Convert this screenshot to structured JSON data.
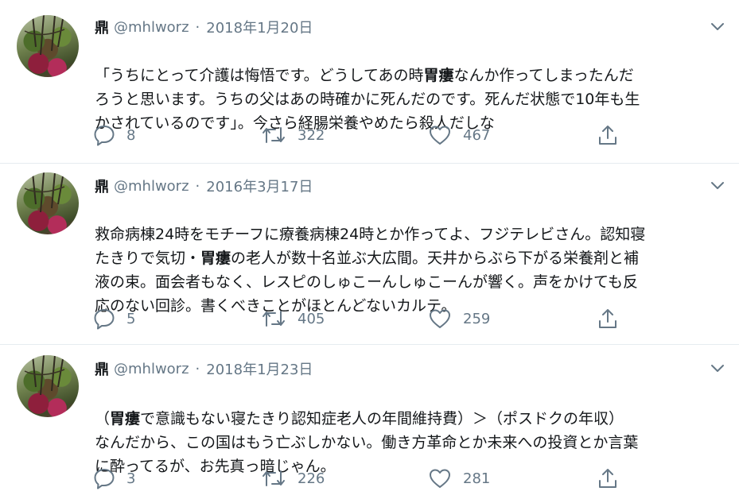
{
  "tweets": [
    {
      "name": "鼎",
      "handle": "@mhlworz",
      "date": "2018年1月20日",
      "text_parts": [
        {
          "t": "「うちにとって介護は悔悟です。どうしてあの時",
          "b": false
        },
        {
          "t": "胃瘻",
          "b": true
        },
        {
          "t": "なんか作ってしまったんだ\nろうと思います。うちの父はあの時確かに死んだのです。死んだ状態で10年も生\nかされているのです」。今さら経腸栄養やめたら殺人だしな",
          "b": false
        }
      ],
      "replies": "8",
      "retweets": "322",
      "likes": "467"
    },
    {
      "name": "鼎",
      "handle": "@mhlworz",
      "date": "2016年3月17日",
      "text_parts": [
        {
          "t": "救命病棟24時をモチーフに療養病棟24時とか作ってよ、フジテレビさん。認知寝\nたきりで気切・",
          "b": false
        },
        {
          "t": "胃瘻",
          "b": true
        },
        {
          "t": "の老人が数十名並ぶ大広間。天井からぶら下がる栄養剤と補\n液の束。面会者もなく、レスピのしゅこーんしゅこーんが響く。声をかけても反\n応のない回診。書くべきことがほとんどないカルテ。",
          "b": false
        }
      ],
      "replies": "5",
      "retweets": "405",
      "likes": "259"
    },
    {
      "name": "鼎",
      "handle": "@mhlworz",
      "date": "2018年1月23日",
      "text_parts": [
        {
          "t": "（",
          "b": false
        },
        {
          "t": "胃瘻",
          "b": true
        },
        {
          "t": "で意識もない寝たきり認知症老人の年間維持費）＞（ポスドクの年収）\nなんだから、この国はもう亡ぶしかない。働き方革命とか未来への投資とか言葉\nに酔ってるが、お先真っ暗じゃん。",
          "b": false
        }
      ],
      "replies": "3",
      "retweets": "226",
      "likes": "281"
    }
  ],
  "icons": {
    "reply": "reply-icon",
    "retweet": "retweet-icon",
    "like": "heart-icon",
    "share": "share-icon",
    "caret": "chevron-down-icon"
  },
  "colors": {
    "text": "#14171a",
    "secondary": "#657786",
    "separator": "#e6ecf0"
  }
}
